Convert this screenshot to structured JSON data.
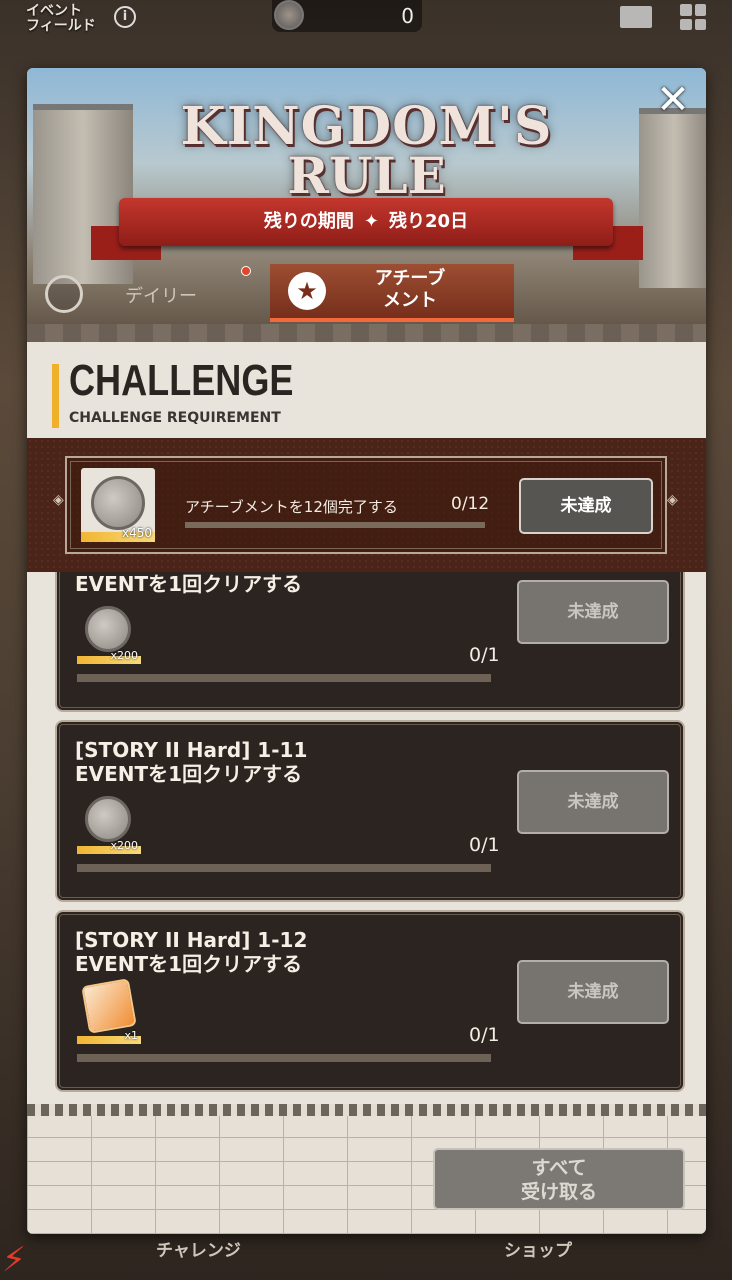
{
  "topbar": {
    "event_field_label": "イベント\nフィールド",
    "coin_count": "0"
  },
  "panel": {
    "logo_line1": "KINGDOM'S",
    "logo_line2": "RULE",
    "period_label": "残りの期間",
    "period_value": "残り20日",
    "tabs": [
      {
        "label": "デイリー",
        "selected": false
      },
      {
        "label": "アチーブ\nメント",
        "selected": true
      }
    ],
    "challenge_title": "CHALLENGE",
    "challenge_subtitle": "CHALLENGE REQUIREMENT"
  },
  "featured": {
    "reward_qty": "x450",
    "text": "アチーブメントを12個完了する",
    "count": "0/12",
    "progress": 0,
    "button": "未達成"
  },
  "items": [
    {
      "title": "EVENTを1回クリアする",
      "reward_qty": "x200",
      "count": "0/1",
      "button": "未達成",
      "reward": "coin",
      "progress": 0
    },
    {
      "title": "[STORY II Hard] 1-11\nEVENTを1回クリアする",
      "reward_qty": "x200",
      "count": "0/1",
      "button": "未達成",
      "reward": "coin",
      "progress": 0
    },
    {
      "title": "[STORY II Hard] 1-12\nEVENTを1回クリアする",
      "reward_qty": "x1",
      "count": "0/1",
      "button": "未達成",
      "reward": "gift",
      "progress": 0
    }
  ],
  "footer": {
    "claim_all": "すべて\n受け取る"
  },
  "bottombar": {
    "challenge": "チャレンジ",
    "shop": "ショップ"
  },
  "colors": {
    "accent": "#f0b12a",
    "ribbon": "#b52d24",
    "tab_active": "#f26a3c"
  }
}
